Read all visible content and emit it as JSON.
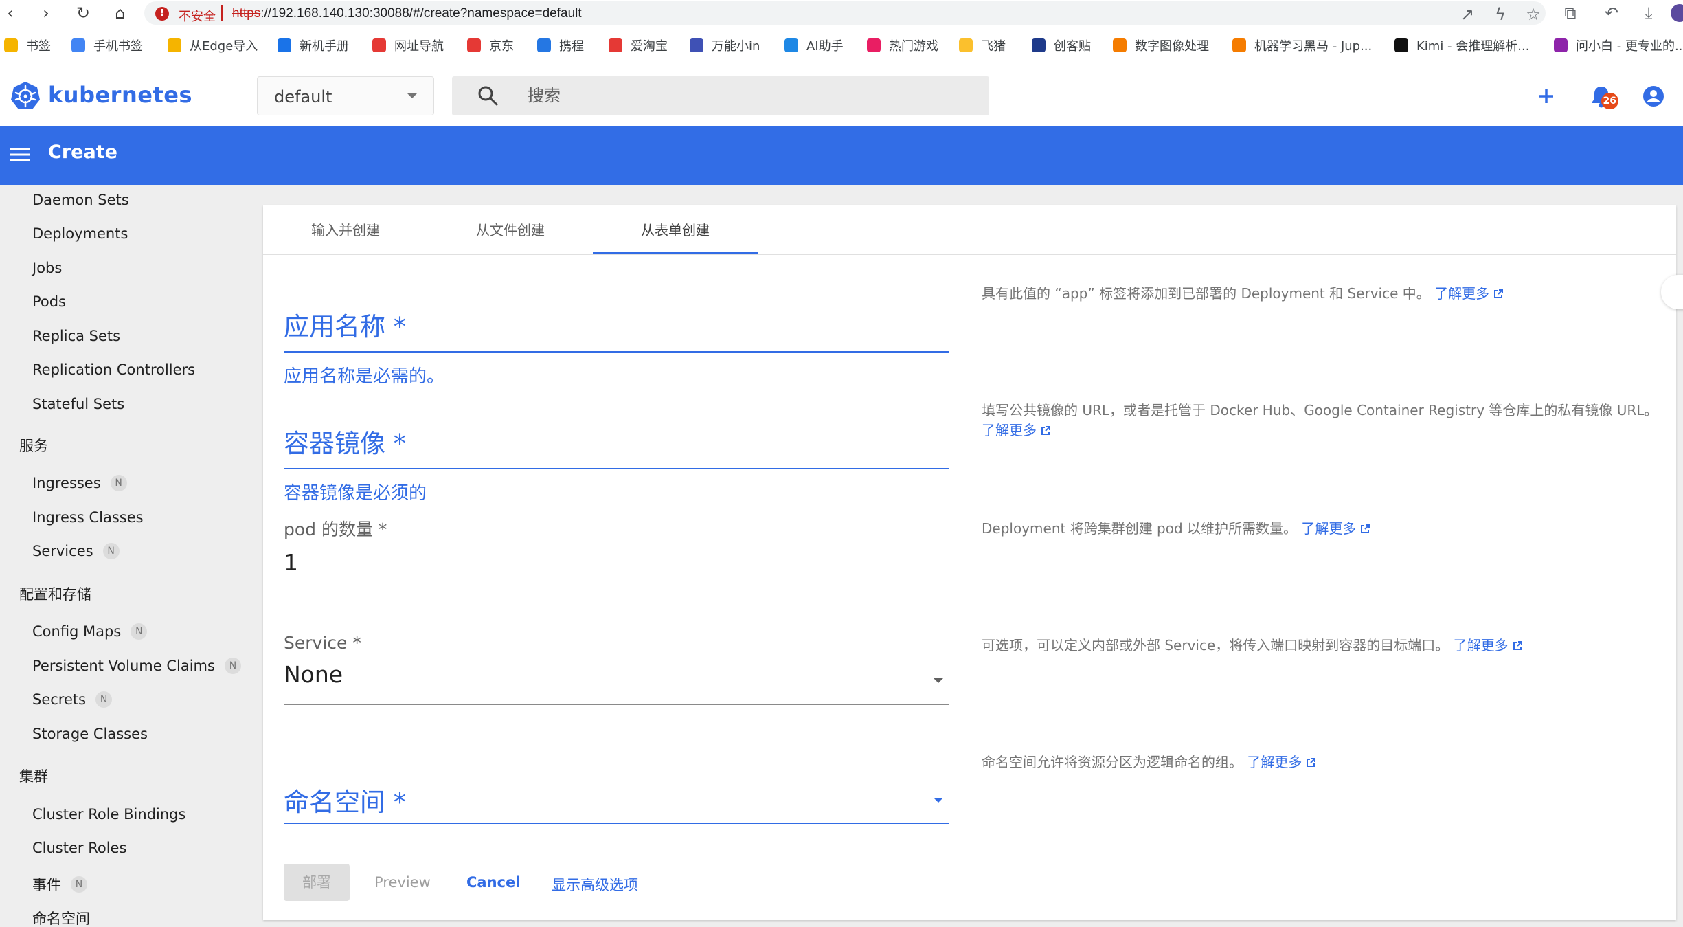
{
  "browser": {
    "security_label": "不安全",
    "url_scheme": "https",
    "url_rest": "://192.168.140.130:30088/#/create?namespace=default",
    "bookmarks": [
      {
        "label": "书签",
        "icon": "star-icon",
        "color": "#f5b400"
      },
      {
        "label": "手机书签",
        "icon": "phone-bookmark-icon",
        "color": "#4285f4"
      },
      {
        "label": "从Edge导入",
        "icon": "folder-icon",
        "color": "#f5b400"
      },
      {
        "label": "新机手册",
        "icon": "book-icon",
        "color": "#1a73e8"
      },
      {
        "label": "网址导航",
        "icon": "nav-icon",
        "color": "#e53935"
      },
      {
        "label": "京东",
        "icon": "jd-icon",
        "color": "#e53935"
      },
      {
        "label": "携程",
        "icon": "ctrip-icon",
        "color": "#2577e3"
      },
      {
        "label": "爱淘宝",
        "icon": "taobao-icon",
        "color": "#e53935"
      },
      {
        "label": "万能小in",
        "icon": "robot-icon",
        "color": "#3f51b5"
      },
      {
        "label": "AI助手",
        "icon": "ai-assistant-icon",
        "color": "#1e88e5"
      },
      {
        "label": "热门游戏",
        "icon": "game-icon",
        "color": "#e91e63"
      },
      {
        "label": "飞猪",
        "icon": "fliggy-icon",
        "color": "#fbc02d"
      },
      {
        "label": "创客贴",
        "icon": "chuangkit-icon",
        "color": "#1e3a8a"
      },
      {
        "label": "数字图像处理",
        "icon": "notebook-icon",
        "color": "#f57c00"
      },
      {
        "label": "机器学习黑马 - Jup...",
        "icon": "notebook-icon",
        "color": "#f57c00"
      },
      {
        "label": "Kimi - 会推理解析...",
        "icon": "kimi-icon",
        "color": "#111111"
      },
      {
        "label": "问小白 - 更专业的...",
        "icon": "wenxiaobai-icon",
        "color": "#8e24aa"
      }
    ]
  },
  "header": {
    "logo_text": "kubernetes",
    "namespace_value": "default",
    "search_placeholder": "搜索",
    "notification_count": "26",
    "brand_color": "#326ce5"
  },
  "toolbar": {
    "title": "Create"
  },
  "sidebar": {
    "workloads": [
      "Daemon Sets",
      "Deployments",
      "Jobs",
      "Pods",
      "Replica Sets",
      "Replication Controllers",
      "Stateful Sets"
    ],
    "service_group": "服务",
    "service_items": [
      {
        "label": "Ingresses",
        "badge": "N"
      },
      {
        "label": "Ingress Classes",
        "badge": ""
      },
      {
        "label": "Services",
        "badge": "N"
      }
    ],
    "config_group": "配置和存储",
    "config_items": [
      {
        "label": "Config Maps",
        "badge": "N"
      },
      {
        "label": "Persistent Volume Claims",
        "badge": "N"
      },
      {
        "label": "Secrets",
        "badge": "N"
      },
      {
        "label": "Storage Classes",
        "badge": ""
      }
    ],
    "cluster_group": "集群",
    "cluster_items": [
      {
        "label": "Cluster Role Bindings",
        "badge": ""
      },
      {
        "label": "Cluster Roles",
        "badge": ""
      },
      {
        "label": "事件",
        "badge": "N"
      },
      {
        "label": "命名空间",
        "badge": ""
      }
    ]
  },
  "tabs": [
    "输入并创建",
    "从文件创建",
    "从表单创建"
  ],
  "active_tab": "从表单创建",
  "form": {
    "app_name_label": "应用名称 *",
    "app_name_error": "应用名称是必需的。",
    "image_label": "容器镜像 *",
    "image_error": "容器镜像是必须的",
    "pods_label": "pod 的数量 *",
    "pods_value": "1",
    "service_label": "Service *",
    "service_value": "None",
    "namespace_label": "命名空间 *"
  },
  "help": {
    "app_name": "具有此值的 “app” 标签将添加到已部署的 Deployment 和 Service 中。",
    "image": "填写公共镜像的 URL，或者是托管于 Docker Hub、Google Container Registry 等仓库上的私有镜像 URL。",
    "pods": "Deployment 将跨集群创建 pod 以维护所需数量。",
    "service": "可选项，可以定义内部或外部 Service，将传入端口映射到容器的目标端口。",
    "namespace": "命名空间允许将资源分区为逻辑命名的组。",
    "learn_more": "了解更多"
  },
  "actions": {
    "deploy": "部署",
    "preview": "Preview",
    "cancel": "Cancel",
    "advanced": "显示高级选项"
  }
}
